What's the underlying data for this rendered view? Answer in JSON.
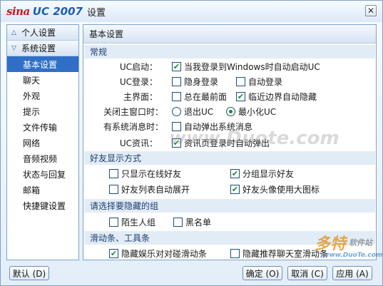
{
  "window": {
    "logo_sina": "sina",
    "logo_uc": "UC 2007",
    "title": "设置",
    "close_label": "✕"
  },
  "sidebar": {
    "personal_settings": "个人设置",
    "system_settings": "系统设置",
    "items": [
      "基本设置",
      "聊天",
      "外观",
      "提示",
      "文件传输",
      "网络",
      "音频视频",
      "状态与回复",
      "邮箱",
      "快捷键设置"
    ],
    "selected_index": 0
  },
  "content": {
    "header": "基本设置",
    "sections": {
      "general": "常规",
      "friend_display": "好友显示方式",
      "hidden_groups": "请选择要隐藏的组",
      "scrollbar_toolbar": "滑动条、工具条"
    },
    "rows": {
      "uc_startup_label": "UC启动：",
      "uc_startup_opt": "当我登录到Windows时自动启动UC",
      "uc_startup_checked": true,
      "uc_login_label": "UC登录：",
      "hidden_login": "隐身登录",
      "hidden_login_checked": false,
      "auto_login": "自动登录",
      "auto_login_checked": false,
      "main_ui_label": "主界面：",
      "always_top": "总在最前面",
      "always_top_checked": false,
      "edge_hide": "临近边界自动隐藏",
      "edge_hide_checked": true,
      "close_main_label": "关闭主窗口时：",
      "exit_uc": "退出UC",
      "minimize_uc": "最小化UC",
      "close_choice": "minimize",
      "sys_msg_label": "有系统消息时：",
      "auto_popup_sys": "自动弹出系统消息",
      "auto_popup_sys_checked": false,
      "uc_news_label": "UC资讯：",
      "news_popup": "资讯页登录时自动弹出",
      "news_popup_checked": true
    },
    "friend_display": {
      "online_only": "只显示在线好友",
      "online_only_checked": false,
      "group_display": "分组显示好友",
      "group_display_checked": true,
      "list_auto_expand": "好友列表自动展开",
      "list_auto_expand_checked": false,
      "large_avatar": "好友头像使用大图标",
      "large_avatar_checked": true
    },
    "hidden_groups": {
      "strangers": "陌生人组",
      "strangers_checked": false,
      "blacklist": "黑名单",
      "blacklist_checked": false
    },
    "scrollbar_toolbar": {
      "hide_game_bar": "隐藏娱乐对对碰滑动条",
      "hide_game_bar_checked": true,
      "hide_chatroom_bar": "隐藏推荐聊天室滑动条",
      "hide_chatroom_bar_checked": false
    }
  },
  "buttons": {
    "default": "默认 (D)",
    "ok": "确定 (O)",
    "cancel": "取消 (C)",
    "apply": "应用 (A)"
  },
  "watermark": {
    "site": "www.Duote.com",
    "brand": "多特",
    "brand_sub": "软件站",
    "url_small": "www.DuoTe.com"
  },
  "colors": {
    "accent": "#2f6fc6",
    "border": "#7fa2c8",
    "check": "#1b8c2a",
    "brand_red": "#d2141c",
    "brand_blue": "#1d5fb0"
  }
}
